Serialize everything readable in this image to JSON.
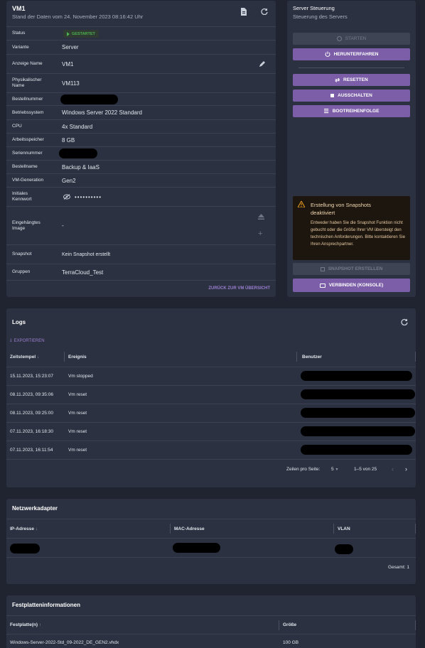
{
  "vm": {
    "title": "VM1",
    "subtitle": "Stand der Daten vom 24. November 2023 08:16:42 Uhr",
    "status_label": "Status",
    "status_value": "GESTARTET",
    "rows": [
      {
        "label": "Variante",
        "value": "Server"
      },
      {
        "label": "Anzeige Name",
        "value": "VM1"
      },
      {
        "label": "Physikalischer Name",
        "value": "VM113"
      },
      {
        "label": "Bestellnummer",
        "value": ""
      },
      {
        "label": "Betriebssystem",
        "value": "Windows Server 2022 Standard"
      },
      {
        "label": "CPU",
        "value": "4x Standard"
      },
      {
        "label": "Arbeitsspeicher",
        "value": "8 GB"
      },
      {
        "label": "Seriennummer",
        "value": ""
      },
      {
        "label": "Bestellname",
        "value": "Backup & IaaS"
      },
      {
        "label": "VM-Generation",
        "value": "Gen2"
      },
      {
        "label": "Initiales Kennwort",
        "value": "••••••••••"
      },
      {
        "label": "Eingehängtes Image",
        "value": "-"
      },
      {
        "label": "Snapshot",
        "value": "Kein Snapshot erstellt"
      },
      {
        "label": "Gruppen",
        "value": "TerraCloud_Test"
      }
    ],
    "back_link": "ZURÜCK ZUR VM ÜBERSICHT"
  },
  "control": {
    "title": "Server Steuerung",
    "subtitle": "Steuerung des Servers",
    "btn_start": "STARTEN",
    "btn_shutdown": "HERUNTERFAHREN",
    "btn_reset": "RESETTEN",
    "btn_off": "AUSSCHALTEN",
    "btn_boot": "BOOTREIHENFOLGE",
    "warn_title": "Erstellung von Snapshots deaktiviert",
    "warn_text": "Entweder haben Sie die Snapshot Funktion nicht gebucht oder die Größe Ihrer VM übersteigt den technischen Anforderungen. Bitte kontaktieren Sie Ihren Ansprechpartner.",
    "btn_snapshot": "SNAPSHOT ERSTELLEN",
    "btn_connect": "VERBINDEN (KONSOLE)"
  },
  "logs": {
    "title": "Logs",
    "export": "EXPORTIEREN",
    "col_time": "Zeitstempel",
    "col_event": "Ereignis",
    "col_user": "Benutzer",
    "rows": [
      {
        "time": "15.11.2023, 15:23:07",
        "event": "Vm stopped"
      },
      {
        "time": "08.11.2023, 09:35:06",
        "event": "Vm reset"
      },
      {
        "time": "08.11.2023, 09:25:00",
        "event": "Vm reset"
      },
      {
        "time": "07.11.2023, 16:18:30",
        "event": "Vm reset"
      },
      {
        "time": "07.11.2023, 16:11:54",
        "event": "Vm reset"
      }
    ],
    "rows_per_page_label": "Zeilen pro Seite:",
    "rows_per_page": "5",
    "range": "1–5 von 25"
  },
  "network": {
    "title": "Netzwerkadapter",
    "col_ip": "IP-Adresse",
    "col_mac": "MAC-Adresse",
    "col_vlan": "VLAN",
    "total": "Gesamt: 1"
  },
  "disk": {
    "title": "Festplatteninformationen",
    "col_disk": "Festplatte(n)",
    "col_size": "Größe",
    "rows": [
      {
        "name": "Windows-Server-2022-Std_09-2022_DE_GEN2.vhdx",
        "size": "100 GB"
      }
    ]
  },
  "colors": {
    "background": "#1f2430",
    "card": "#2b3141",
    "accent": "#7b5ea7",
    "success": "#4caf50",
    "warning": "#f0a020"
  }
}
